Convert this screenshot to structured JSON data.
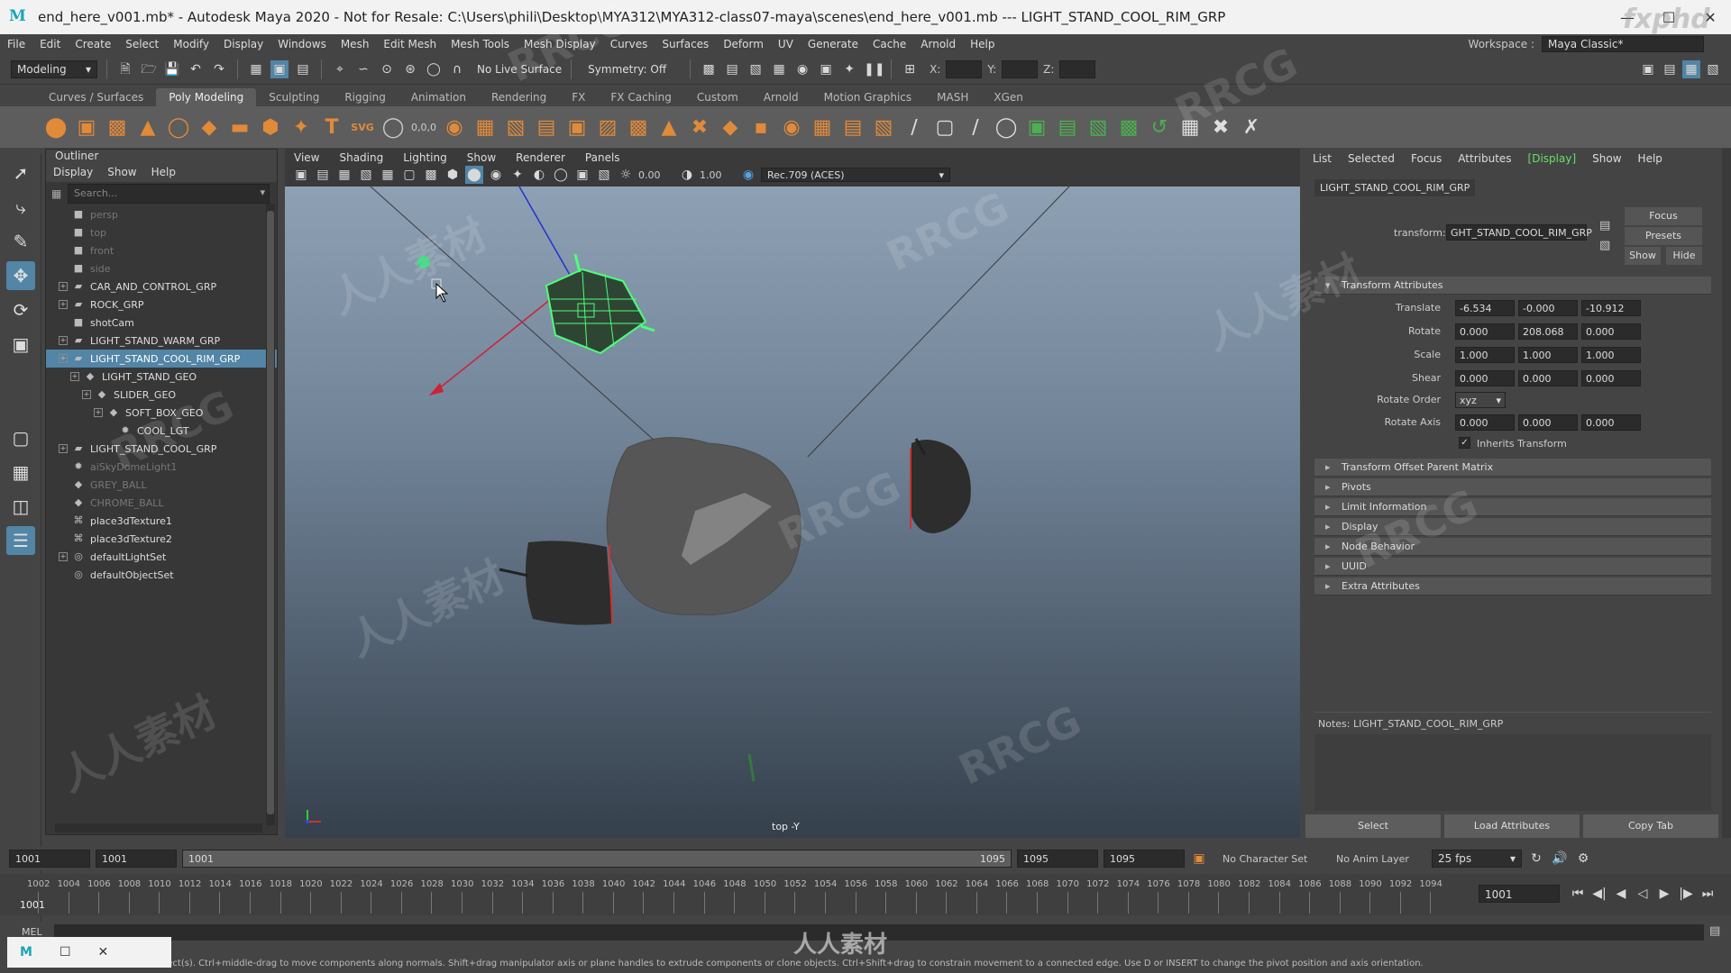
{
  "window": {
    "title": "end_here_v001.mb* - Autodesk Maya 2020 - Not for Resale: C:\\Users\\phili\\Desktop\\MYA312\\MYA312-class07-maya\\scenes\\end_here_v001.mb  ---  LIGHT_STAND_COOL_RIM_GRP",
    "app_logo": "M"
  },
  "menus": [
    "File",
    "Edit",
    "Create",
    "Select",
    "Modify",
    "Display",
    "Windows",
    "Mesh",
    "Edit Mesh",
    "Mesh Tools",
    "Mesh Display",
    "Curves",
    "Surfaces",
    "Deform",
    "UV",
    "Generate",
    "Cache",
    "Arnold",
    "Help"
  ],
  "workspace": {
    "label": "Workspace :",
    "value": "Maya Classic*"
  },
  "statusline": {
    "mode": "Modeling",
    "live_surface": "No Live Surface",
    "symmetry": "Symmetry: Off",
    "x_label": "X:",
    "y_label": "Y:",
    "z_label": "Z:"
  },
  "shelf_tabs": [
    "Curves / Surfaces",
    "Poly Modeling",
    "Sculpting",
    "Rigging",
    "Animation",
    "Rendering",
    "FX",
    "FX Caching",
    "Custom",
    "Arnold",
    "Motion Graphics",
    "MASH",
    "XGen"
  ],
  "shelf_active": "Poly Modeling",
  "outliner": {
    "title": "Outliner",
    "menu": [
      "Display",
      "Show",
      "Help"
    ],
    "search_placeholder": "Search...",
    "items": [
      {
        "label": "persp",
        "dim": true,
        "indent": 0,
        "icon": "camera-icon",
        "exp": false
      },
      {
        "label": "top",
        "dim": true,
        "indent": 0,
        "icon": "camera-icon",
        "exp": false
      },
      {
        "label": "front",
        "dim": true,
        "indent": 0,
        "icon": "camera-icon",
        "exp": false
      },
      {
        "label": "side",
        "dim": true,
        "indent": 0,
        "icon": "camera-icon",
        "exp": false
      },
      {
        "label": "CAR_AND_CONTROL_GRP",
        "dim": false,
        "indent": 0,
        "icon": "group-icon",
        "exp": true
      },
      {
        "label": "ROCK_GRP",
        "dim": false,
        "indent": 0,
        "icon": "group-icon",
        "exp": true
      },
      {
        "label": "shotCam",
        "dim": false,
        "indent": 0,
        "icon": "camera-icon",
        "exp": false
      },
      {
        "label": "LIGHT_STAND_WARM_GRP",
        "dim": false,
        "indent": 0,
        "icon": "group-icon",
        "exp": true
      },
      {
        "label": "LIGHT_STAND_COOL_RIM_GRP",
        "dim": false,
        "indent": 0,
        "icon": "group-icon",
        "exp": true,
        "selected": true
      },
      {
        "label": "LIGHT_STAND_GEO",
        "dim": false,
        "indent": 1,
        "icon": "mesh-icon",
        "exp": true
      },
      {
        "label": "SLIDER_GEO",
        "dim": false,
        "indent": 2,
        "icon": "mesh-icon",
        "exp": true
      },
      {
        "label": "SOFT_BOX_GEO",
        "dim": false,
        "indent": 3,
        "icon": "mesh-icon",
        "exp": true
      },
      {
        "label": "COOL_LGT",
        "dim": false,
        "indent": 4,
        "icon": "light-icon",
        "exp": false
      },
      {
        "label": "LIGHT_STAND_COOL_GRP",
        "dim": false,
        "indent": 0,
        "icon": "group-icon",
        "exp": true
      },
      {
        "label": "aiSkyDomeLight1",
        "dim": true,
        "indent": 0,
        "icon": "light-icon",
        "exp": false
      },
      {
        "label": "GREY_BALL",
        "dim": true,
        "indent": 0,
        "icon": "mesh-icon",
        "exp": false
      },
      {
        "label": "CHROME_BALL",
        "dim": true,
        "indent": 0,
        "icon": "mesh-icon",
        "exp": false
      },
      {
        "label": "place3dTexture1",
        "dim": false,
        "indent": 0,
        "icon": "texture-icon",
        "exp": false
      },
      {
        "label": "place3dTexture2",
        "dim": false,
        "indent": 0,
        "icon": "texture-icon",
        "exp": false
      },
      {
        "label": "defaultLightSet",
        "dim": false,
        "indent": 0,
        "icon": "set-icon",
        "exp": true
      },
      {
        "label": "defaultObjectSet",
        "dim": false,
        "indent": 0,
        "icon": "set-icon",
        "exp": false
      }
    ]
  },
  "viewport": {
    "menu": [
      "View",
      "Shading",
      "Lighting",
      "Show",
      "Renderer",
      "Panels"
    ],
    "exposure": "0.00",
    "gamma": "1.00",
    "colorspace": "Rec.709 (ACES)",
    "camera_label": "top -Y"
  },
  "attribute_editor": {
    "menu": [
      "List",
      "Selected",
      "Focus",
      "Attributes",
      "Display",
      "Show",
      "Help"
    ],
    "menu_active": "Display",
    "node_tab": "LIGHT_STAND_COOL_RIM_GRP",
    "transform_label": "transform:",
    "transform_value": "GHT_STAND_COOL_RIM_GRP",
    "buttons": {
      "focus": "Focus",
      "presets": "Presets",
      "show": "Show",
      "hide": "Hide"
    },
    "section_transform": "Transform Attributes",
    "translate": {
      "label": "Translate",
      "values": [
        "-6.534",
        "-0.000",
        "-10.912"
      ]
    },
    "rotate": {
      "label": "Rotate",
      "values": [
        "0.000",
        "208.068",
        "0.000"
      ]
    },
    "scale": {
      "label": "Scale",
      "values": [
        "1.000",
        "1.000",
        "1.000"
      ]
    },
    "shear": {
      "label": "Shear",
      "values": [
        "0.000",
        "0.000",
        "0.000"
      ]
    },
    "rotate_order": {
      "label": "Rotate Order",
      "value": "xyz"
    },
    "rotate_axis": {
      "label": "Rotate Axis",
      "values": [
        "0.000",
        "0.000",
        "0.000"
      ]
    },
    "inherits_transform": "Inherits Transform",
    "sections": [
      "Transform Offset Parent Matrix",
      "Pivots",
      "Limit Information",
      "Display",
      "Node Behavior",
      "UUID",
      "Extra Attributes"
    ],
    "notes": "Notes:  LIGHT_STAND_COOL_RIM_GRP",
    "bottom_buttons": [
      "Select",
      "Load Attributes",
      "Copy Tab"
    ]
  },
  "timeline": {
    "start": "1001",
    "range_start": "1001",
    "playback_start": "1001",
    "range_end": "1095",
    "end": "1095",
    "end2": "1095",
    "character_set": "No Character Set",
    "anim_layer": "No Anim Layer",
    "fps": "25 fps",
    "current_frame": "1001",
    "ticks": [
      "1002",
      "1004",
      "1006",
      "1008",
      "1010",
      "1012",
      "1014",
      "1016",
      "1018",
      "1020",
      "1022",
      "1024",
      "1026",
      "1028",
      "1030",
      "1032",
      "1034",
      "1036",
      "1038",
      "1040",
      "1042",
      "1044",
      "1046",
      "1048",
      "1050",
      "1052",
      "1054",
      "1056",
      "1058",
      "1060",
      "1062",
      "1064",
      "1066",
      "1068",
      "1070",
      "1072",
      "1074",
      "1076",
      "1078",
      "1080",
      "1082",
      "1084",
      "1086",
      "1088",
      "1090",
      "1092",
      "1094"
    ],
    "ruler_current": "1001"
  },
  "command": {
    "label": "MEL",
    "help": "object(s). Ctrl+middle-drag to move components along normals. Shift+drag manipulator axis or plane handles to extrude components or clone objects. Ctrl+Shift+drag to constrain movement to a connected edge. Use D or INSERT to change the pivot position and axis orientation."
  },
  "watermarks": {
    "a": "RRCG",
    "b": "人人素材",
    "brand": "人人素材",
    "corner": "fxphd"
  }
}
